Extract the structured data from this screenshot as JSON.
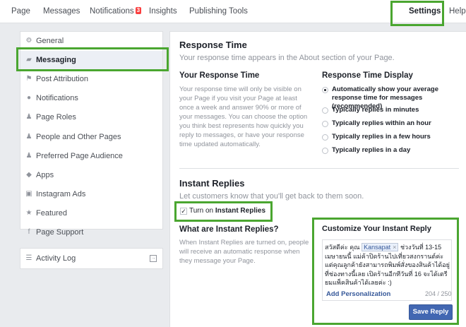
{
  "topnav": {
    "tabs": [
      {
        "label": "Page"
      },
      {
        "label": "Messages"
      },
      {
        "label": "Notifications",
        "badge": "3"
      },
      {
        "label": "Insights"
      },
      {
        "label": "Publishing Tools"
      },
      {
        "label": "Settings"
      },
      {
        "label": "Help"
      }
    ]
  },
  "sidebar": {
    "items": [
      {
        "label": "General",
        "icon": "gear-icon"
      },
      {
        "label": "Messaging",
        "icon": "chat-bubbles-icon",
        "active": true
      },
      {
        "label": "Post Attribution",
        "icon": "flag-icon"
      },
      {
        "label": "Notifications",
        "icon": "globe-icon"
      },
      {
        "label": "Page Roles",
        "icon": "person-icon"
      },
      {
        "label": "People and Other Pages",
        "icon": "person-plus-icon"
      },
      {
        "label": "Preferred Page Audience",
        "icon": "person-target-icon"
      },
      {
        "label": "Apps",
        "icon": "cube-icon"
      },
      {
        "label": "Instagram Ads",
        "icon": "camera-icon"
      },
      {
        "label": "Featured",
        "icon": "star-icon"
      },
      {
        "label": "Page Support",
        "icon": "facebook-icon"
      }
    ],
    "activity_log": "Activity Log"
  },
  "response_time": {
    "title": "Response Time",
    "subtitle": "Your response time appears in the About section of your Page.",
    "left_heading": "Your Response Time",
    "left_body": "Your response time will only be visible on your Page if you visit your Page at least once a week and answer 90% or more of your messages. You can choose the option you think best represents how quickly you reply to messages, or have your response time updated automatically.",
    "right_heading": "Response Time Display",
    "options": [
      {
        "label": "Automatically show your average response time for messages (recommended)",
        "selected": true
      },
      {
        "label": "Typically replies in minutes",
        "selected": false
      },
      {
        "label": "Typically replies within an hour",
        "selected": false
      },
      {
        "label": "Typically replies in a few hours",
        "selected": false
      },
      {
        "label": "Typically replies in a day",
        "selected": false
      }
    ]
  },
  "instant_replies": {
    "title": "Instant Replies",
    "subtitle": "Let customers know that you'll get back to them soon.",
    "toggle_prefix": "Turn on",
    "toggle_bold": "Instant Replies",
    "checked": true,
    "what_heading": "What are Instant Replies?",
    "what_body": "When Instant Replies are turned on, people will receive an automatic response when they message your Page.",
    "customize_title": "Customize Your Instant Reply",
    "message_before": "สวัสดีค่ะ คุณ",
    "token": "Kansapat",
    "message_after": "ช่วงวันที่ 13-15 เมษายนนี้ แม่ค้าปิดร้านไปเที่ยวสงกรานต์ค่ะ แต่คุณลูกค้ายังสามารถพิมพ์สั่งของสินค้าได้อยู่ที่ช่องทางนี้เลย เปิดร้านอีกทีวันที่ 16 จะได้เตรียมแพ็คสินค้าได้เลยค่ะ :)",
    "add_personalization": "Add Personalization",
    "counter": "204 / 250",
    "save_label": "Save Reply"
  },
  "colors": {
    "highlight": "#4aa630",
    "link": "#365899",
    "button": "#4267b2",
    "badge": "#fa3e3e"
  }
}
